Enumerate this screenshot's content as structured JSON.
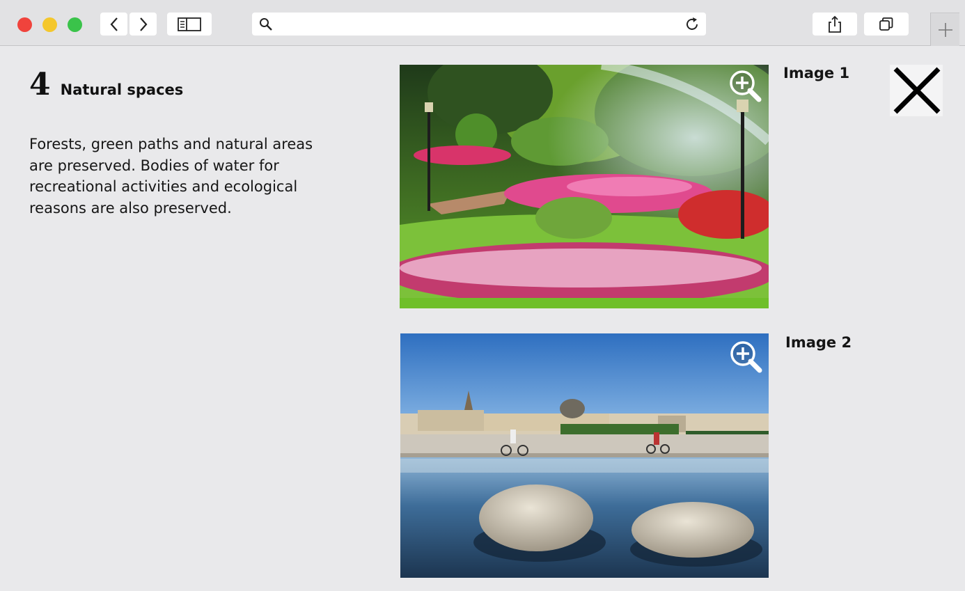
{
  "browser": {
    "icons": {
      "back": "chevron-left-icon",
      "forward": "chevron-right-icon",
      "sidebar": "sidebar-icon",
      "search": "search-icon",
      "reload": "reload-icon",
      "share": "share-icon",
      "tabs": "tabs-overview-icon",
      "new_tab": "plus-icon"
    },
    "colors": {
      "close": "#f0433c",
      "minimize": "#f4c72c",
      "maximize": "#3ac34a"
    }
  },
  "section": {
    "number": "4",
    "title": "Natural spaces",
    "body": "Forests, green paths and natural areas are preserved. Bodies of water for recreational activities and ecological reasons are also preserved."
  },
  "images": [
    {
      "label": "Image 1",
      "icon": "zoom-in-icon"
    },
    {
      "label": "Image 2",
      "icon": "zoom-in-icon"
    }
  ],
  "close": {
    "icon": "close-icon"
  }
}
